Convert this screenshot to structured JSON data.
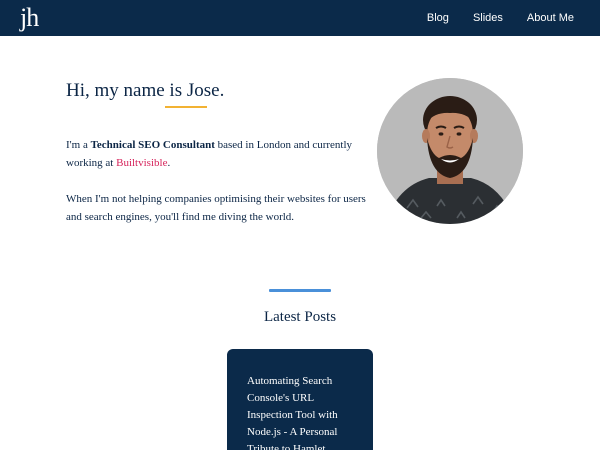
{
  "nav": {
    "logo": "jh",
    "links": [
      "Blog",
      "Slides",
      "About Me"
    ]
  },
  "hero": {
    "title": "Hi, my name is Jose.",
    "intro_prefix": "I'm a ",
    "intro_bold": "Technical SEO Consultant",
    "intro_mid": " based in London and currently working at ",
    "intro_link": "Builtvisible",
    "intro_suffix": ".",
    "paragraph2": "When I'm not helping companies optimising their websites for users and search engines, you'll find me diving the world."
  },
  "latest": {
    "title": "Latest Posts",
    "posts": [
      {
        "title": "Automating Search Console's URL Inspection Tool with Node.js - A Personal Tribute to Hamlet"
      }
    ]
  },
  "colors": {
    "navy": "#0b2a4a",
    "accent_yellow": "#f2b233",
    "accent_blue": "#4a90d9",
    "link_pink": "#d6245c"
  }
}
